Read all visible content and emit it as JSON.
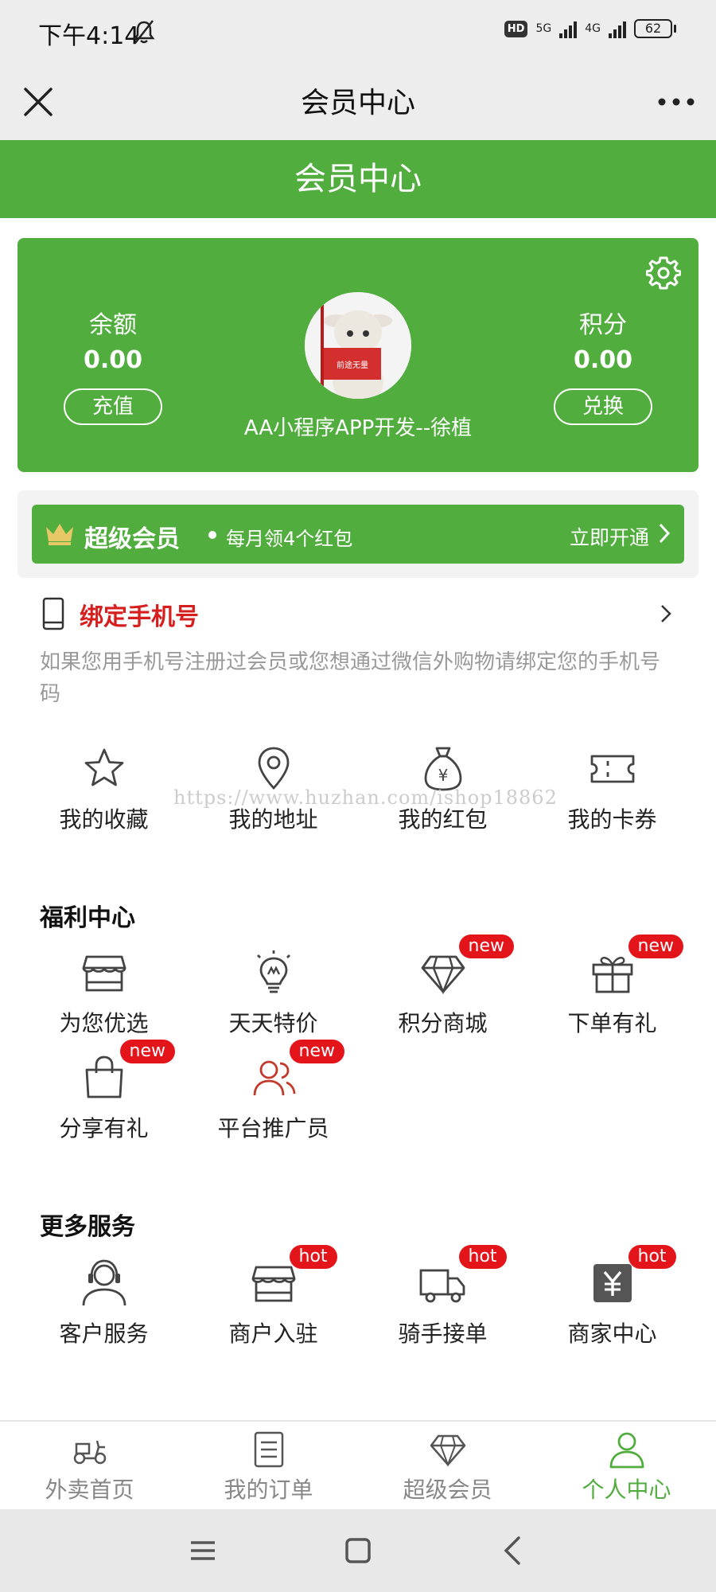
{
  "status_bar": {
    "time": "下午4:14",
    "hd": "HD",
    "net1": "5G",
    "net2": "4G",
    "battery": "62"
  },
  "title_bar": {
    "title": "会员中心"
  },
  "header": {
    "title": "会员中心"
  },
  "member_card": {
    "balance_label": "余额",
    "balance_value": "0.00",
    "recharge_label": "充值",
    "points_label": "积分",
    "points_value": "0.00",
    "exchange_label": "兑换",
    "nickname": "AA小程序APP开发--徐植",
    "avatar_stamp": "前途无量"
  },
  "vip": {
    "title": "超级会员",
    "subtitle": "每月领4个红包",
    "action": "立即开通"
  },
  "bind_phone": {
    "title": "绑定手机号",
    "description": "如果您用手机号注册过会员或您想通过微信外购物请绑定您的手机号码"
  },
  "quick_links": [
    {
      "label": "我的收藏",
      "icon": "star-icon"
    },
    {
      "label": "我的地址",
      "icon": "location-pin-icon"
    },
    {
      "label": "我的红包",
      "icon": "money-bag-icon"
    },
    {
      "label": "我的卡券",
      "icon": "ticket-icon"
    }
  ],
  "watermark": "https://www.huzhan.com/ishop18862",
  "welfare": {
    "title": "福利中心",
    "items": [
      {
        "label": "为您优选",
        "icon": "store-icon",
        "badge": ""
      },
      {
        "label": "天天特价",
        "icon": "lightbulb-icon",
        "badge": ""
      },
      {
        "label": "积分商城",
        "icon": "diamond-icon",
        "badge": "new"
      },
      {
        "label": "下单有礼",
        "icon": "gift-icon",
        "badge": "new"
      },
      {
        "label": "分享有礼",
        "icon": "shopping-bag-icon",
        "badge": "new"
      },
      {
        "label": "平台推广员",
        "icon": "users-icon",
        "badge": "new"
      }
    ]
  },
  "services": {
    "title": "更多服务",
    "items": [
      {
        "label": "客户服务",
        "icon": "headset-icon",
        "badge": ""
      },
      {
        "label": "商户入驻",
        "icon": "store-icon",
        "badge": "hot"
      },
      {
        "label": "骑手接单",
        "icon": "delivery-truck-icon",
        "badge": "hot"
      },
      {
        "label": "商家中心",
        "icon": "yen-icon",
        "badge": "hot"
      }
    ]
  },
  "tab_bar": [
    {
      "label": "外卖首页",
      "icon": "scooter-icon",
      "active": false
    },
    {
      "label": "我的订单",
      "icon": "order-list-icon",
      "active": false
    },
    {
      "label": "超级会员",
      "icon": "diamond-icon",
      "active": false
    },
    {
      "label": "个人中心",
      "icon": "person-icon",
      "active": true
    }
  ],
  "colors": {
    "brand_green": "#52ad3f",
    "alert_red": "#e4141b",
    "bind_title_red": "#d62020"
  }
}
